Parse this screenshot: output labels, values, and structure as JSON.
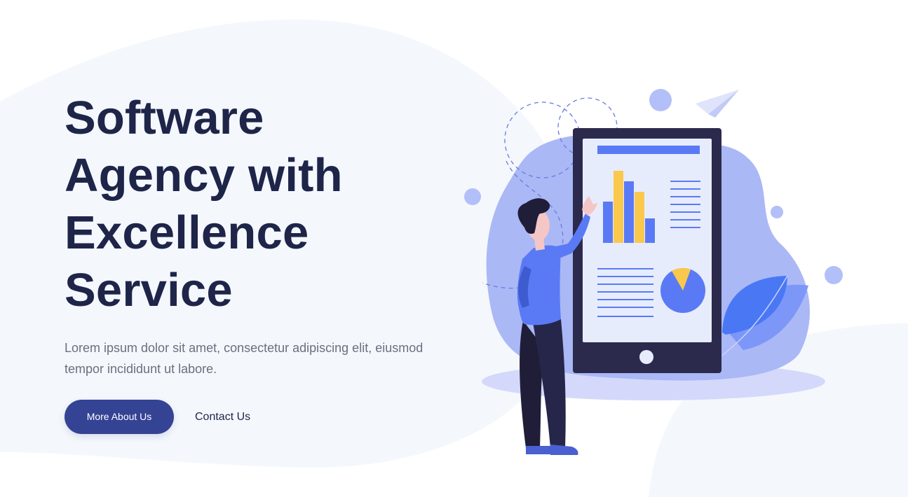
{
  "hero": {
    "title_lines": [
      "Software",
      "Agency with",
      "Excellence",
      "Service"
    ],
    "description_lines": [
      "Lorem ipsum dolor sit amet, consectetur adipiscing elit, eiusmod",
      "tempor incididunt ut labore."
    ],
    "primary_button": "More About Us",
    "secondary_link": "Contact Us"
  },
  "colors": {
    "background": "#ffffff",
    "blob": "#f4f8fc",
    "heading": "#1e2549",
    "body_text": "#6b6f7e",
    "button": "#354394",
    "accent_blue": "#5a7af5",
    "accent_yellow": "#f9c84c",
    "phone_frame": "#2b2a4c"
  },
  "illustration": {
    "name": "person-with-phone-dashboard",
    "icons": [
      "paper-plane-icon",
      "bar-chart-icon",
      "pie-chart-icon",
      "leaf-icon"
    ]
  }
}
